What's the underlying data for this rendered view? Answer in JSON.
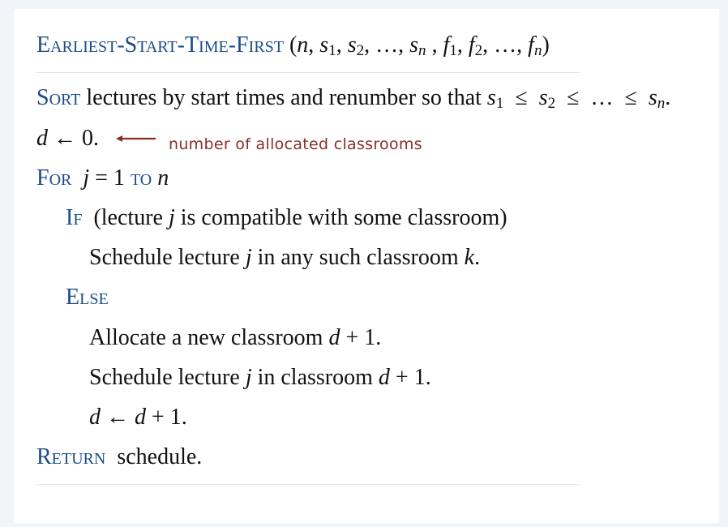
{
  "header": {
    "name": "Earliest-Start-Time-First",
    "params": "(n, s1, s2, …, sn , f1, f2, …, fn)"
  },
  "lines": {
    "sort_keyword": "Sort",
    "sort_text": "lectures by start times and renumber so that",
    "init": "d ← 0.",
    "for_keyword": "For",
    "for_mid": "j = 1",
    "to_keyword": "to",
    "for_end": "n",
    "if_keyword": "If",
    "if_text": "(lecture j is compatible with some classroom)",
    "schedule_any": "Schedule lecture j in any such classroom k.",
    "else_keyword": "Else",
    "allocate": "Allocate a new classroom d + 1.",
    "schedule_new": "Schedule lecture j in classroom d + 1.",
    "increment": "d ← d + 1.",
    "return_keyword": "Return",
    "return_text": "schedule."
  },
  "annotation": {
    "text": "number of allocated classrooms",
    "color": "#8b2e28"
  },
  "colors": {
    "keyword": "#1a4d8a",
    "background": "#f2f5f8",
    "card": "#ffffff"
  }
}
